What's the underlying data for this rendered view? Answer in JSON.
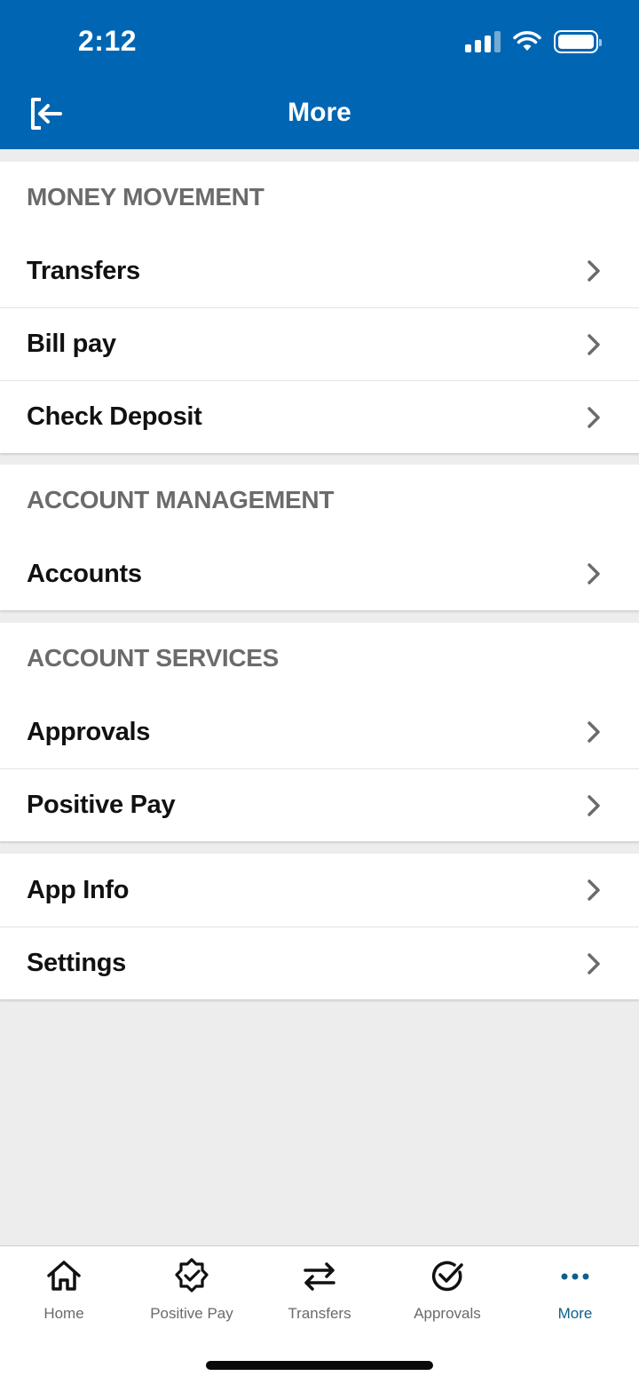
{
  "status_bar": {
    "time": "2:12"
  },
  "header": {
    "title": "More",
    "logout_icon": "logout-icon"
  },
  "sections": {
    "money_movement": {
      "title": "MONEY MOVEMENT",
      "items": [
        "Transfers",
        "Bill pay",
        "Check Deposit"
      ]
    },
    "account_management": {
      "title": "ACCOUNT MANAGEMENT",
      "items": [
        "Accounts"
      ]
    },
    "account_services": {
      "title": "ACCOUNT SERVICES",
      "items": [
        "Approvals",
        "Positive Pay"
      ]
    },
    "misc": {
      "items": [
        "App Info",
        "Settings"
      ]
    }
  },
  "tabs": [
    {
      "label": "Home",
      "icon": "home-icon"
    },
    {
      "label": "Positive Pay",
      "icon": "badge-check-icon"
    },
    {
      "label": "Transfers",
      "icon": "transfer-arrows-icon"
    },
    {
      "label": "Approvals",
      "icon": "check-circle-icon"
    },
    {
      "label": "More",
      "icon": "more-dots-icon",
      "active": true
    }
  ],
  "colors": {
    "brand": "#0066b3",
    "active_tab": "#0d5f8c",
    "background": "#ededed"
  }
}
